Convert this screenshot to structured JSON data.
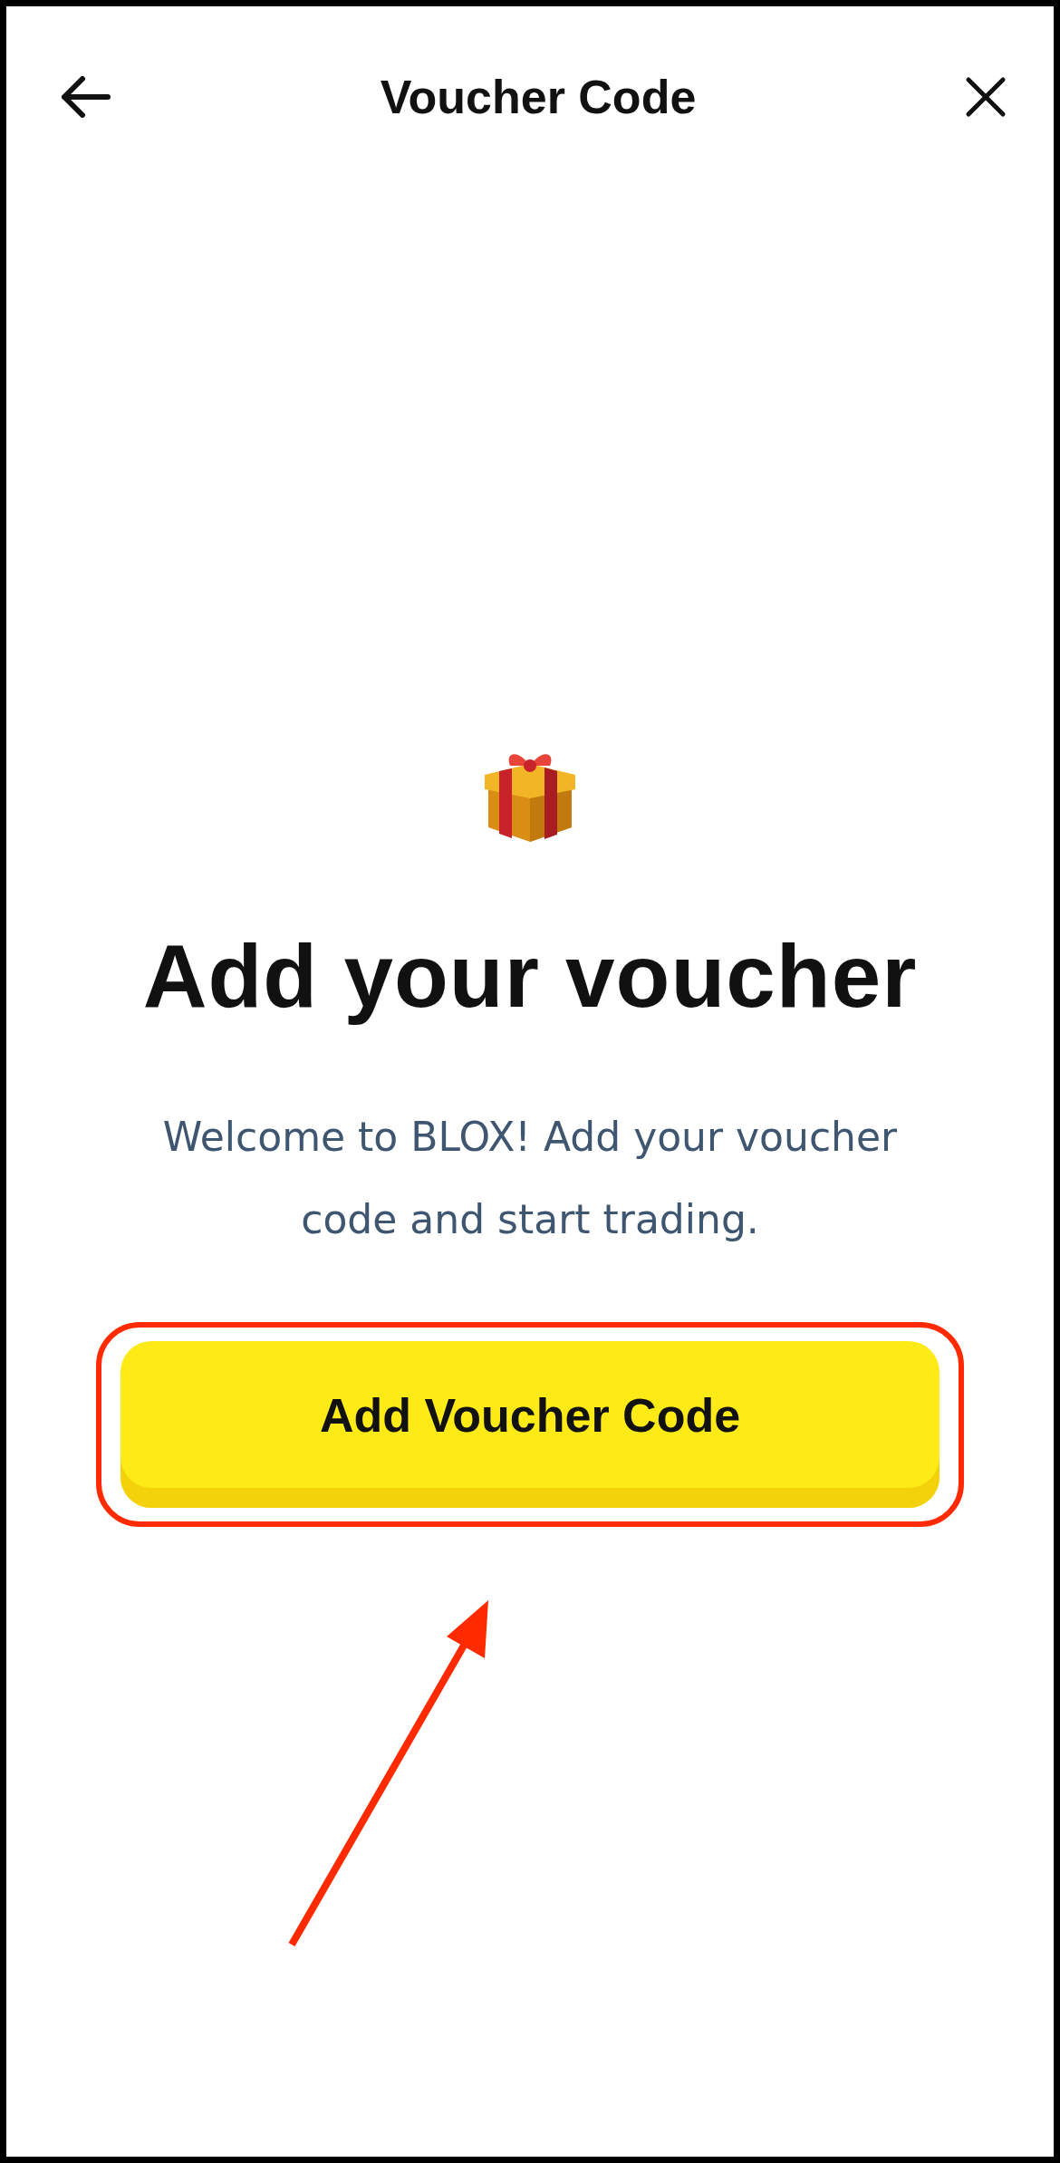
{
  "header": {
    "title": "Voucher Code"
  },
  "hero": {
    "heading": "Add your voucher",
    "description": "Welcome to BLOX! Add your voucher code and start trading."
  },
  "primary_button": {
    "label": "Add Voucher Code",
    "highlighted": true
  }
}
